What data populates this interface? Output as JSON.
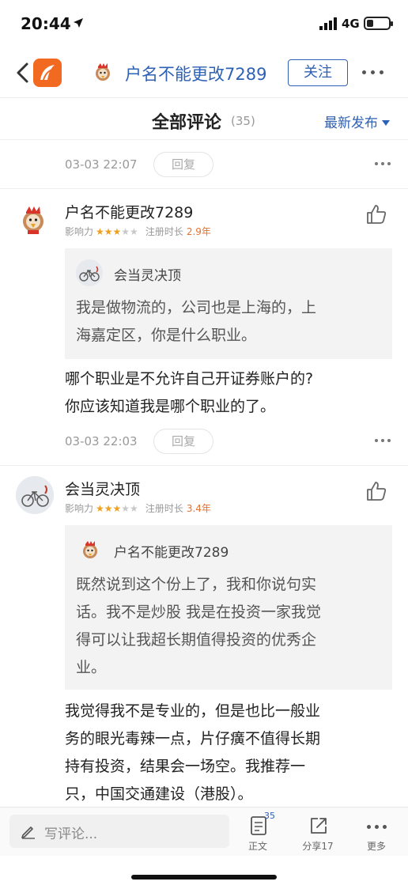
{
  "status_bar": {
    "time": "20:44",
    "network": "4G",
    "battery_level": 0.3
  },
  "nav": {
    "back_icon": "chevron-left-icon",
    "app_logo": "app-logo-icon",
    "title": "户名不能更改7289",
    "follow_label": "关注",
    "more_icon": "more-horizontal-icon"
  },
  "comments_header": {
    "title": "全部评论",
    "count": "(35)",
    "sort_label": "最新发布"
  },
  "top_partial": {
    "time": "03-03 22:07",
    "reply_label": "回复"
  },
  "comments": [
    {
      "user": "户名不能更改7289",
      "influence_label": "影响力",
      "stars": "★★★",
      "stars_off": "★★",
      "reg_label": "注册时长",
      "reg_value": "2.9年",
      "quote_user": "会当灵决顶",
      "quote_lines": [
        "我是做物流的，公司也是上海的，上",
        "海嘉定区，你是什么职业。"
      ],
      "body_lines": [
        "哪个职业是不允许自己开证券账户的?",
        "你应该知道我是哪个职业的了。"
      ],
      "time": "03-03 22:03",
      "reply_label": "回复"
    },
    {
      "user": "会当灵决顶",
      "influence_label": "影响力",
      "stars": "★★★",
      "stars_off": "★★",
      "reg_label": "注册时长",
      "reg_value": "3.4年",
      "quote_user": "户名不能更改7289",
      "quote_lines": [
        "既然说到这个份上了，我和你说句实",
        "话。我不是炒股 我是在投资一家我觉",
        "得可以让我超长期值得投资的优秀企",
        "业。"
      ],
      "body_lines": [
        "我觉得我不是专业的，但是也比一般业",
        "务的眼光毒辣一点，片仔癀不值得长期",
        "持有投资，结果会一场空。我推荐一",
        "只，中国交通建设（港股）。"
      ]
    }
  ],
  "bottom_bar": {
    "write_placeholder": "写评论...",
    "article_label": "正文",
    "article_badge": "35",
    "share_label": "分享17",
    "more_label": "更多"
  },
  "colors": {
    "link_blue": "#2d61b5",
    "star_orange": "#f0a020",
    "reg_orange": "#e8722c",
    "logo_orange": "#f26a21"
  }
}
